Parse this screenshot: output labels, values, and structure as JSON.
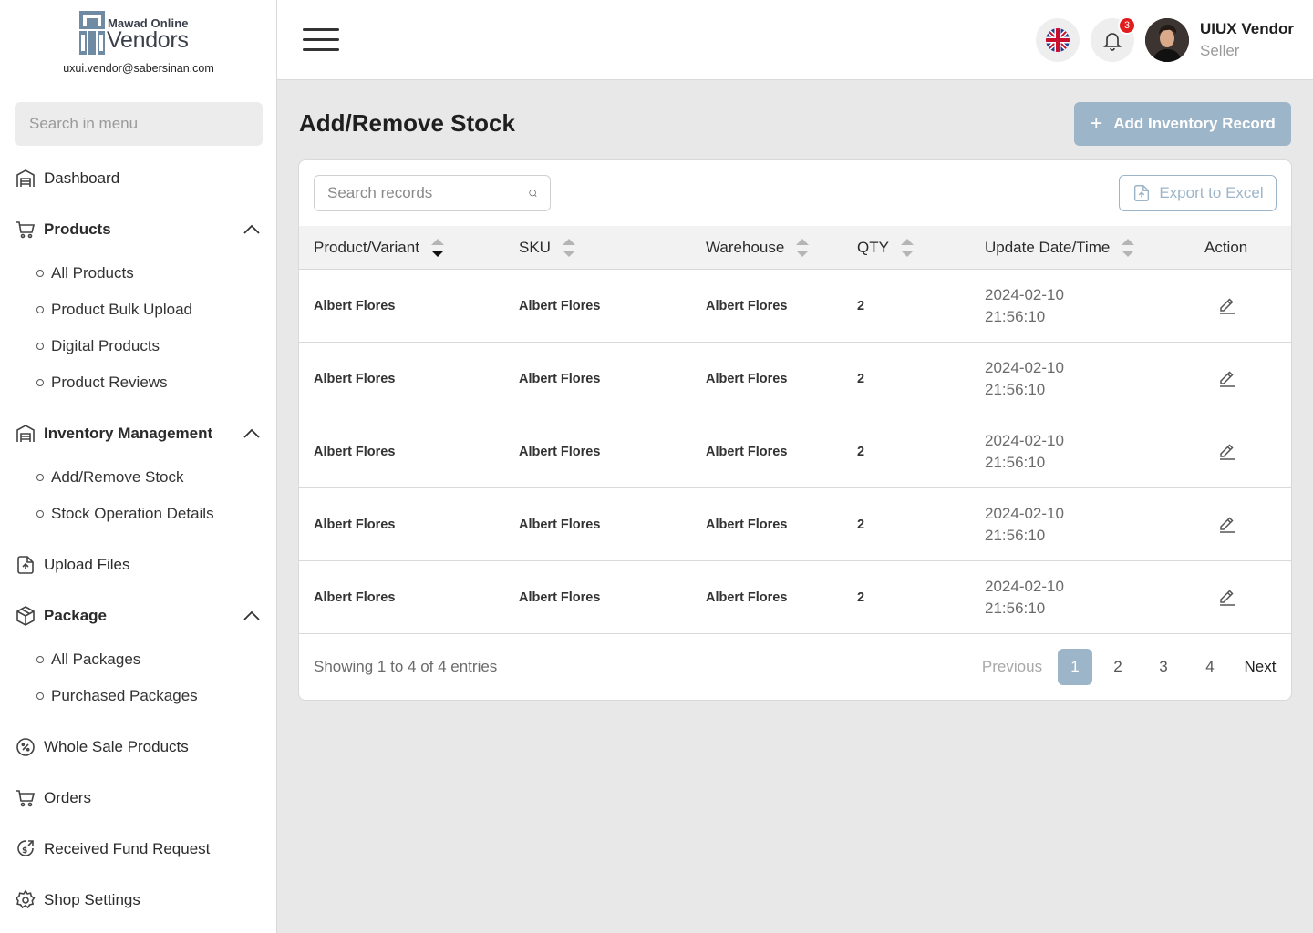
{
  "brand": {
    "name_top": "Mawad Online",
    "name_main": "Vendors",
    "email": "uxui.vendor@sabersinan.com"
  },
  "sidebar": {
    "search_placeholder": "Search in menu",
    "dashboard": "Dashboard",
    "products": {
      "label": "Products",
      "items": [
        "All Products",
        "Product Bulk Upload",
        "Digital Products",
        "Product Reviews"
      ]
    },
    "inventory": {
      "label": "Inventory Management",
      "items": [
        "Add/Remove Stock",
        "Stock Operation Details"
      ]
    },
    "upload_files": "Upload Files",
    "package": {
      "label": "Package",
      "items": [
        "All Packages",
        "Purchased Packages"
      ]
    },
    "wholesale": "Whole Sale Products",
    "orders": "Orders",
    "fund_request": "Received Fund Request",
    "shop_settings": "Shop Settings"
  },
  "header": {
    "notification_count": "3",
    "user_name": "UIUX Vendor",
    "user_role": "Seller",
    "language_icon": "uk-flag-icon"
  },
  "page": {
    "title": "Add/Remove Stock",
    "add_button": "Add Inventory Record",
    "search_placeholder": "Search records",
    "export_button": "Export to Excel"
  },
  "table": {
    "columns": [
      "Product/Variant",
      "SKU",
      "Warehouse",
      "QTY",
      "Update Date/Time",
      "Action"
    ],
    "rows": [
      {
        "product": "Albert Flores",
        "sku": "Albert Flores",
        "warehouse": "Albert Flores",
        "qty": "2",
        "date": "2024-02-10",
        "time": "21:56:10"
      },
      {
        "product": "Albert Flores",
        "sku": "Albert Flores",
        "warehouse": "Albert Flores",
        "qty": "2",
        "date": "2024-02-10",
        "time": "21:56:10"
      },
      {
        "product": "Albert Flores",
        "sku": "Albert Flores",
        "warehouse": "Albert Flores",
        "qty": "2",
        "date": "2024-02-10",
        "time": "21:56:10"
      },
      {
        "product": "Albert Flores",
        "sku": "Albert Flores",
        "warehouse": "Albert Flores",
        "qty": "2",
        "date": "2024-02-10",
        "time": "21:56:10"
      },
      {
        "product": "Albert Flores",
        "sku": "Albert Flores",
        "warehouse": "Albert Flores",
        "qty": "2",
        "date": "2024-02-10",
        "time": "21:56:10"
      }
    ]
  },
  "pagination": {
    "info": "Showing 1 to 4 of 4 entries",
    "previous": "Previous",
    "pages": [
      "1",
      "2",
      "3",
      "4"
    ],
    "active_page": "1",
    "next": "Next"
  },
  "colors": {
    "accent": "#9db5c8",
    "badge": "#e21b1b",
    "background": "#e8e8e8"
  }
}
